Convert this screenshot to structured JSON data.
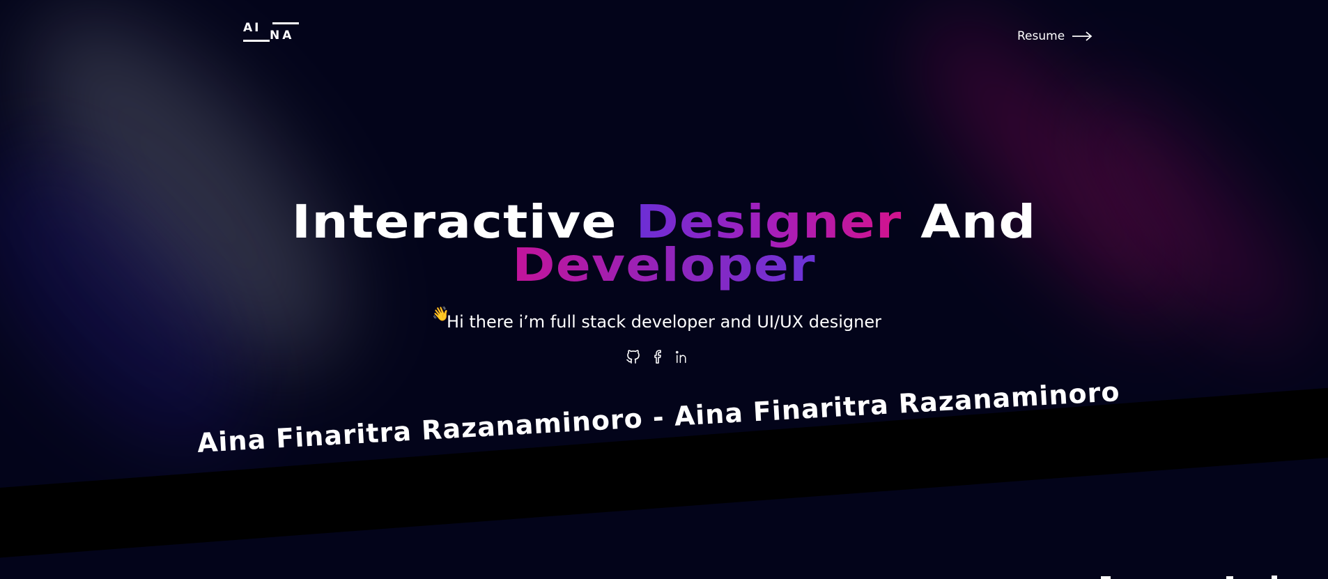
{
  "header": {
    "logo_top": "AI",
    "logo_bottom": "NA",
    "resume_label": "Resume",
    "arrow_icon": "arrow-right-icon"
  },
  "hero": {
    "title_word_1": "Interactive",
    "title_word_2": "Designer",
    "title_word_3": "And",
    "title_word_4": "Developer",
    "wave_icon": "👋",
    "subtitle": "Hi there i’m full stack developer and UI/UX designer"
  },
  "socials": {
    "icons": [
      "github-icon",
      "facebook-icon",
      "linkedin-icon"
    ]
  },
  "banner": {
    "text": "Aina Finaritra Razanaminoro - Aina Finaritra Razanaminoro"
  },
  "colors": {
    "background": "#03041a",
    "gradient_purple": "#6b2fd6",
    "gradient_pink": "#d3138c",
    "text": "#ffffff",
    "band": "#000000"
  }
}
